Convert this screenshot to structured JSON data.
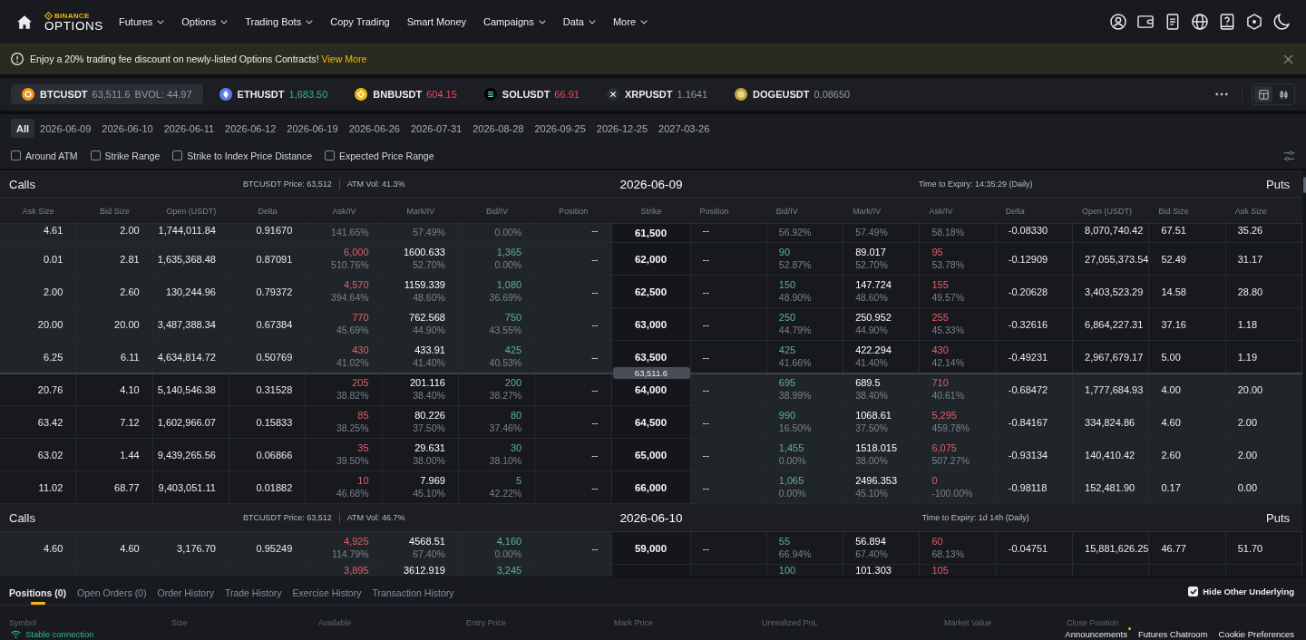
{
  "nav": {
    "logo": {
      "brand": "BINANCE",
      "product": "OPTIONS"
    },
    "items": [
      {
        "label": "Futures",
        "dropdown": true
      },
      {
        "label": "Options",
        "dropdown": true
      },
      {
        "label": "Trading Bots",
        "dropdown": true
      },
      {
        "label": "Copy Trading",
        "dropdown": false
      },
      {
        "label": "Smart Money",
        "dropdown": false
      },
      {
        "label": "Campaigns",
        "dropdown": true
      },
      {
        "label": "Data",
        "dropdown": true
      },
      {
        "label": "More",
        "dropdown": true
      }
    ]
  },
  "banner": {
    "text": "Enjoy a 20% trading fee discount on newly-listed Options Contracts!",
    "link": "View More"
  },
  "tickers": [
    {
      "kind": "btc",
      "symbol": "BTCUSDT",
      "price": "63,511.6",
      "extra": "BVOL: 44.97",
      "rising": false,
      "falling": false,
      "color": "#f7931a",
      "selected": true
    },
    {
      "kind": "eth",
      "symbol": "ETHUSDT",
      "price": "1,683.50",
      "rising": true,
      "falling": false,
      "color": "#627eea",
      "selected": false
    },
    {
      "kind": "bnb",
      "symbol": "BNBUSDT",
      "price": "604.15",
      "rising": false,
      "falling": true,
      "color": "#f0b90b",
      "selected": false
    },
    {
      "kind": "sol",
      "symbol": "SOLUSDT",
      "price": "66.91",
      "rising": false,
      "falling": true,
      "color": "#000000",
      "selected": false
    },
    {
      "kind": "xrp",
      "symbol": "XRPUSDT",
      "price": "1.1641",
      "rising": false,
      "falling": false,
      "color": "#2b2f36",
      "selected": false
    },
    {
      "kind": "doge",
      "symbol": "DOGEUSDT",
      "price": "0.08650",
      "rising": false,
      "falling": false,
      "color": "#c2a633",
      "selected": false
    }
  ],
  "view_toggle": [
    {
      "kind": "table",
      "selected": true
    },
    {
      "kind": "chart",
      "selected": false
    }
  ],
  "expiries": [
    {
      "label": "All",
      "selected": true
    },
    {
      "label": "2026-06-09",
      "selected": false
    },
    {
      "label": "2026-06-10",
      "selected": false
    },
    {
      "label": "2026-06-11",
      "selected": false
    },
    {
      "label": "2026-06-12",
      "selected": false
    },
    {
      "label": "2026-06-19",
      "selected": false
    },
    {
      "label": "2026-06-26",
      "selected": false
    },
    {
      "label": "2026-07-31",
      "selected": false
    },
    {
      "label": "2026-08-28",
      "selected": false
    },
    {
      "label": "2026-09-25",
      "selected": false
    },
    {
      "label": "2026-12-25",
      "selected": false
    },
    {
      "label": "2027-03-26",
      "selected": false
    }
  ],
  "filters": [
    {
      "label": "Around ATM",
      "checked": false
    },
    {
      "label": "Strike Range",
      "checked": false
    },
    {
      "label": "Strike to Index Price Distance",
      "checked": false
    },
    {
      "label": "Expected Price Range",
      "checked": false
    }
  ],
  "option_chain": {
    "columns": {
      "calls": [
        "Ask Size",
        "Bid Size",
        "Open (USDT)",
        "Delta",
        "Ask/IV",
        "Mark/IV",
        "Bid/IV",
        "Position"
      ],
      "strike": "Strike",
      "puts": [
        "Position",
        "Bid/IV",
        "Mark/IV",
        "Ask/IV",
        "Delta",
        "Open (USDT)",
        "Bid Size",
        "Ask Size"
      ]
    },
    "sections": [
      {
        "calls_label": "Calls",
        "underlying_price": "BTCUSDT Price: 63,512",
        "atm_vol": "ATM Vol: 41.3%",
        "expiry": "2026-06-09",
        "time_to_expiry": "Time to Expiry: 14:35:29 (Daily)",
        "puts_label": "Puts",
        "rows": [
          {
            "kind": "top_cut",
            "strike": "61,500",
            "calls_itm": true,
            "puts_itm": false,
            "calls": {
              "ask_size": "4.61",
              "bid_size": "2.00",
              "open": "1,744,011.84",
              "delta": "0.91670",
              "ask_iv": "141.65%",
              "mark_iv": "57.49%",
              "bid_iv": "0.00%",
              "position": "--"
            },
            "puts": {
              "position": "--",
              "bid_iv": "56.92%",
              "mark_iv": "57.49%",
              "ask_iv": "58.18%",
              "delta": "-0.08330",
              "open": "8,070,740.42",
              "bid_size": "67.51",
              "ask_size": "35.26"
            }
          },
          {
            "kind": "full",
            "strike": "62,000",
            "calls_itm": true,
            "puts_itm": false,
            "calls": {
              "ask_size": "0.01",
              "bid_size": "2.81",
              "open": "1,635,368.48",
              "delta": "0.87091",
              "ask": "6,000",
              "ask_iv": "510.76%",
              "mark": "1600.633",
              "mark_iv": "52.70%",
              "bid": "1,365",
              "bid_iv": "0.00%",
              "position": "--"
            },
            "puts": {
              "position": "--",
              "bid": "90",
              "bid_iv": "52.87%",
              "mark": "89.017",
              "mark_iv": "52.70%",
              "ask": "95",
              "ask_iv": "53.78%",
              "delta": "-0.12909",
              "open": "27,055,373.54",
              "bid_size": "52.49",
              "ask_size": "31.17"
            }
          },
          {
            "kind": "full",
            "strike": "62,500",
            "calls_itm": true,
            "puts_itm": false,
            "calls": {
              "ask_size": "2.00",
              "bid_size": "2.60",
              "open": "130,244.96",
              "delta": "0.79372",
              "ask": "4,570",
              "ask_iv": "394.64%",
              "mark": "1159.339",
              "mark_iv": "48.60%",
              "bid": "1,080",
              "bid_iv": "36.69%",
              "position": "--"
            },
            "puts": {
              "position": "--",
              "bid": "150",
              "bid_iv": "48.90%",
              "mark": "147.724",
              "mark_iv": "48.60%",
              "ask": "155",
              "ask_iv": "49.57%",
              "delta": "-0.20628",
              "open": "3,403,523.29",
              "bid_size": "14.58",
              "ask_size": "28.80"
            }
          },
          {
            "kind": "full",
            "strike": "63,000",
            "calls_itm": true,
            "puts_itm": false,
            "calls": {
              "ask_size": "20.00",
              "bid_size": "20.00",
              "open": "3,487,388.34",
              "delta": "0.67384",
              "ask": "770",
              "ask_iv": "45.69%",
              "mark": "762.568",
              "mark_iv": "44.90%",
              "bid": "750",
              "bid_iv": "43.55%",
              "position": "--"
            },
            "puts": {
              "position": "--",
              "bid": "250",
              "bid_iv": "44.79%",
              "mark": "250.952",
              "mark_iv": "44.90%",
              "ask": "255",
              "ask_iv": "45.33%",
              "delta": "-0.32616",
              "open": "6,864,227.31",
              "bid_size": "37.16",
              "ask_size": "1.18"
            }
          },
          {
            "kind": "full",
            "strike": "63,500",
            "calls_itm": true,
            "puts_itm": false,
            "calls": {
              "ask_size": "6.25",
              "bid_size": "6.11",
              "open": "4,634,814.72",
              "delta": "0.50769",
              "ask": "430",
              "ask_iv": "41.02%",
              "mark": "433.91",
              "mark_iv": "41.40%",
              "bid": "425",
              "bid_iv": "40.53%",
              "position": "--"
            },
            "puts": {
              "position": "--",
              "bid": "425",
              "bid_iv": "41.66%",
              "mark": "422.294",
              "mark_iv": "41.40%",
              "ask": "430",
              "ask_iv": "42.14%",
              "delta": "-0.49231",
              "open": "2,967,679.17",
              "bid_size": "5.00",
              "ask_size": "1.19"
            }
          },
          {
            "kind": "index_price",
            "label": "63,511.6"
          },
          {
            "kind": "full",
            "strike": "64,000",
            "calls_itm": false,
            "puts_itm": true,
            "calls": {
              "ask_size": "20.76",
              "bid_size": "4.10",
              "open": "5,140,546.38",
              "delta": "0.31528",
              "ask": "205",
              "ask_iv": "38.82%",
              "mark": "201.116",
              "mark_iv": "38.40%",
              "bid": "200",
              "bid_iv": "38.27%",
              "position": "--"
            },
            "puts": {
              "position": "--",
              "bid": "695",
              "bid_iv": "38.99%",
              "mark": "689.5",
              "mark_iv": "38.40%",
              "ask": "710",
              "ask_iv": "40.61%",
              "delta": "-0.68472",
              "open": "1,777,684.93",
              "bid_size": "4.00",
              "ask_size": "20.00"
            }
          },
          {
            "kind": "full",
            "strike": "64,500",
            "calls_itm": false,
            "puts_itm": true,
            "calls": {
              "ask_size": "63.42",
              "bid_size": "7.12",
              "open": "1,602,966.07",
              "delta": "0.15833",
              "ask": "85",
              "ask_iv": "38.25%",
              "mark": "80.226",
              "mark_iv": "37.50%",
              "bid": "80",
              "bid_iv": "37.46%",
              "position": "--"
            },
            "puts": {
              "position": "--",
              "bid": "990",
              "bid_iv": "16.50%",
              "mark": "1068.61",
              "mark_iv": "37.50%",
              "ask": "5,295",
              "ask_iv": "459.78%",
              "delta": "-0.84167",
              "open": "334,824.86",
              "bid_size": "4.60",
              "ask_size": "2.00"
            }
          },
          {
            "kind": "full",
            "strike": "65,000",
            "calls_itm": false,
            "puts_itm": true,
            "calls": {
              "ask_size": "63.02",
              "bid_size": "1.44",
              "open": "9,439,265.56",
              "delta": "0.06866",
              "ask": "35",
              "ask_iv": "39.50%",
              "mark": "29.631",
              "mark_iv": "38.00%",
              "bid": "30",
              "bid_iv": "38.10%",
              "position": "--"
            },
            "puts": {
              "position": "--",
              "bid": "1,455",
              "bid_iv": "0.00%",
              "mark": "1518.015",
              "mark_iv": "38.00%",
              "ask": "6,075",
              "ask_iv": "507.27%",
              "delta": "-0.93134",
              "open": "140,410.42",
              "bid_size": "2.60",
              "ask_size": "2.00"
            }
          },
          {
            "kind": "full",
            "strike": "66,000",
            "calls_itm": false,
            "puts_itm": true,
            "calls": {
              "ask_size": "11.02",
              "bid_size": "68.77",
              "open": "9,403,051.11",
              "delta": "0.01882",
              "ask": "10",
              "ask_iv": "46.68%",
              "mark": "7.969",
              "mark_iv": "45.10%",
              "bid": "5",
              "bid_iv": "42.22%",
              "position": "--"
            },
            "puts": {
              "position": "--",
              "bid": "1,065",
              "bid_iv": "0.00%",
              "mark": "2496.353",
              "mark_iv": "45.10%",
              "ask": "0",
              "ask_iv": "-100.00%",
              "delta": "-0.98118",
              "open": "152,481.90",
              "bid_size": "0.17",
              "ask_size": "0.00"
            }
          }
        ]
      },
      {
        "calls_label": "Calls",
        "underlying_price": "BTCUSDT Price: 63,512",
        "atm_vol": "ATM Vol: 46.7%",
        "expiry": "2026-06-10",
        "time_to_expiry": "Time to Expiry: 1d 14h (Daily)",
        "puts_label": "Puts",
        "rows": [
          {
            "kind": "full",
            "strike": "59,000",
            "calls_itm": true,
            "puts_itm": false,
            "calls": {
              "ask_size": "4.60",
              "bid_size": "4.60",
              "open": "3,176.70",
              "delta": "0.95249",
              "ask": "4,925",
              "ask_iv": "114.79%",
              "mark": "4568.51",
              "mark_iv": "67.40%",
              "bid": "4,160",
              "bid_iv": "0.00%",
              "position": "--"
            },
            "puts": {
              "position": "--",
              "bid": "55",
              "bid_iv": "66.94%",
              "mark": "56.894",
              "mark_iv": "67.40%",
              "ask": "60",
              "ask_iv": "68.13%",
              "delta": "-0.04751",
              "open": "15,881,626.25",
              "bid_size": "46.77",
              "ask_size": "51.70"
            }
          },
          {
            "kind": "bottom_cut",
            "calls_itm": true,
            "puts_itm": false,
            "calls": {
              "ask": "3,895",
              "mark": "3612.919",
              "bid": "3,245"
            },
            "puts": {
              "bid": "100",
              "mark": "101.303",
              "ask": "105"
            }
          }
        ]
      }
    ]
  },
  "bottom_panel": {
    "tabs": [
      {
        "label": "Positions (0)",
        "selected": true
      },
      {
        "label": "Open Orders (0)",
        "selected": false
      },
      {
        "label": "Order History",
        "selected": false
      },
      {
        "label": "Trade History",
        "selected": false
      },
      {
        "label": "Exercise History",
        "selected": false
      },
      {
        "label": "Transaction History",
        "selected": false
      }
    ],
    "hide_other_underlying": {
      "label": "Hide Other Underlying",
      "checked": true
    },
    "columns": [
      "Symbol",
      "Size",
      "Available",
      "Entry Price",
      "Mark Price",
      "Unrealized PnL",
      "Market Value",
      "Close Position"
    ],
    "status": "Stable connection",
    "footer_links": [
      {
        "label": "Announcements",
        "dot": true
      },
      {
        "label": "Futures Chatroom",
        "dot": false
      },
      {
        "label": "Cookie Preferences",
        "dot": false
      }
    ]
  }
}
